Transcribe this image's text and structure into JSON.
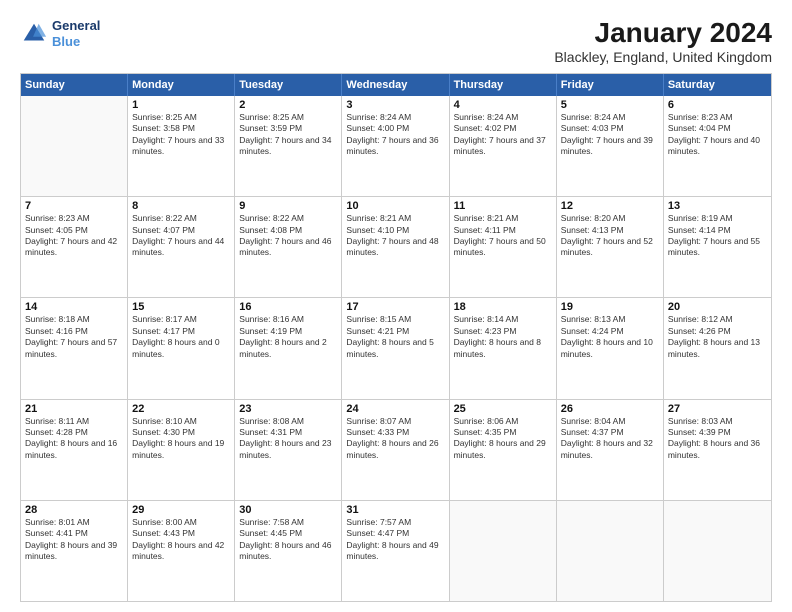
{
  "logo": {
    "line1": "General",
    "line2": "Blue"
  },
  "title": "January 2024",
  "location": "Blackley, England, United Kingdom",
  "weekdays": [
    "Sunday",
    "Monday",
    "Tuesday",
    "Wednesday",
    "Thursday",
    "Friday",
    "Saturday"
  ],
  "weeks": [
    [
      {
        "day": "",
        "sunrise": "",
        "sunset": "",
        "daylight": ""
      },
      {
        "day": "1",
        "sunrise": "Sunrise: 8:25 AM",
        "sunset": "Sunset: 3:58 PM",
        "daylight": "Daylight: 7 hours and 33 minutes."
      },
      {
        "day": "2",
        "sunrise": "Sunrise: 8:25 AM",
        "sunset": "Sunset: 3:59 PM",
        "daylight": "Daylight: 7 hours and 34 minutes."
      },
      {
        "day": "3",
        "sunrise": "Sunrise: 8:24 AM",
        "sunset": "Sunset: 4:00 PM",
        "daylight": "Daylight: 7 hours and 36 minutes."
      },
      {
        "day": "4",
        "sunrise": "Sunrise: 8:24 AM",
        "sunset": "Sunset: 4:02 PM",
        "daylight": "Daylight: 7 hours and 37 minutes."
      },
      {
        "day": "5",
        "sunrise": "Sunrise: 8:24 AM",
        "sunset": "Sunset: 4:03 PM",
        "daylight": "Daylight: 7 hours and 39 minutes."
      },
      {
        "day": "6",
        "sunrise": "Sunrise: 8:23 AM",
        "sunset": "Sunset: 4:04 PM",
        "daylight": "Daylight: 7 hours and 40 minutes."
      }
    ],
    [
      {
        "day": "7",
        "sunrise": "Sunrise: 8:23 AM",
        "sunset": "Sunset: 4:05 PM",
        "daylight": "Daylight: 7 hours and 42 minutes."
      },
      {
        "day": "8",
        "sunrise": "Sunrise: 8:22 AM",
        "sunset": "Sunset: 4:07 PM",
        "daylight": "Daylight: 7 hours and 44 minutes."
      },
      {
        "day": "9",
        "sunrise": "Sunrise: 8:22 AM",
        "sunset": "Sunset: 4:08 PM",
        "daylight": "Daylight: 7 hours and 46 minutes."
      },
      {
        "day": "10",
        "sunrise": "Sunrise: 8:21 AM",
        "sunset": "Sunset: 4:10 PM",
        "daylight": "Daylight: 7 hours and 48 minutes."
      },
      {
        "day": "11",
        "sunrise": "Sunrise: 8:21 AM",
        "sunset": "Sunset: 4:11 PM",
        "daylight": "Daylight: 7 hours and 50 minutes."
      },
      {
        "day": "12",
        "sunrise": "Sunrise: 8:20 AM",
        "sunset": "Sunset: 4:13 PM",
        "daylight": "Daylight: 7 hours and 52 minutes."
      },
      {
        "day": "13",
        "sunrise": "Sunrise: 8:19 AM",
        "sunset": "Sunset: 4:14 PM",
        "daylight": "Daylight: 7 hours and 55 minutes."
      }
    ],
    [
      {
        "day": "14",
        "sunrise": "Sunrise: 8:18 AM",
        "sunset": "Sunset: 4:16 PM",
        "daylight": "Daylight: 7 hours and 57 minutes."
      },
      {
        "day": "15",
        "sunrise": "Sunrise: 8:17 AM",
        "sunset": "Sunset: 4:17 PM",
        "daylight": "Daylight: 8 hours and 0 minutes."
      },
      {
        "day": "16",
        "sunrise": "Sunrise: 8:16 AM",
        "sunset": "Sunset: 4:19 PM",
        "daylight": "Daylight: 8 hours and 2 minutes."
      },
      {
        "day": "17",
        "sunrise": "Sunrise: 8:15 AM",
        "sunset": "Sunset: 4:21 PM",
        "daylight": "Daylight: 8 hours and 5 minutes."
      },
      {
        "day": "18",
        "sunrise": "Sunrise: 8:14 AM",
        "sunset": "Sunset: 4:23 PM",
        "daylight": "Daylight: 8 hours and 8 minutes."
      },
      {
        "day": "19",
        "sunrise": "Sunrise: 8:13 AM",
        "sunset": "Sunset: 4:24 PM",
        "daylight": "Daylight: 8 hours and 10 minutes."
      },
      {
        "day": "20",
        "sunrise": "Sunrise: 8:12 AM",
        "sunset": "Sunset: 4:26 PM",
        "daylight": "Daylight: 8 hours and 13 minutes."
      }
    ],
    [
      {
        "day": "21",
        "sunrise": "Sunrise: 8:11 AM",
        "sunset": "Sunset: 4:28 PM",
        "daylight": "Daylight: 8 hours and 16 minutes."
      },
      {
        "day": "22",
        "sunrise": "Sunrise: 8:10 AM",
        "sunset": "Sunset: 4:30 PM",
        "daylight": "Daylight: 8 hours and 19 minutes."
      },
      {
        "day": "23",
        "sunrise": "Sunrise: 8:08 AM",
        "sunset": "Sunset: 4:31 PM",
        "daylight": "Daylight: 8 hours and 23 minutes."
      },
      {
        "day": "24",
        "sunrise": "Sunrise: 8:07 AM",
        "sunset": "Sunset: 4:33 PM",
        "daylight": "Daylight: 8 hours and 26 minutes."
      },
      {
        "day": "25",
        "sunrise": "Sunrise: 8:06 AM",
        "sunset": "Sunset: 4:35 PM",
        "daylight": "Daylight: 8 hours and 29 minutes."
      },
      {
        "day": "26",
        "sunrise": "Sunrise: 8:04 AM",
        "sunset": "Sunset: 4:37 PM",
        "daylight": "Daylight: 8 hours and 32 minutes."
      },
      {
        "day": "27",
        "sunrise": "Sunrise: 8:03 AM",
        "sunset": "Sunset: 4:39 PM",
        "daylight": "Daylight: 8 hours and 36 minutes."
      }
    ],
    [
      {
        "day": "28",
        "sunrise": "Sunrise: 8:01 AM",
        "sunset": "Sunset: 4:41 PM",
        "daylight": "Daylight: 8 hours and 39 minutes."
      },
      {
        "day": "29",
        "sunrise": "Sunrise: 8:00 AM",
        "sunset": "Sunset: 4:43 PM",
        "daylight": "Daylight: 8 hours and 42 minutes."
      },
      {
        "day": "30",
        "sunrise": "Sunrise: 7:58 AM",
        "sunset": "Sunset: 4:45 PM",
        "daylight": "Daylight: 8 hours and 46 minutes."
      },
      {
        "day": "31",
        "sunrise": "Sunrise: 7:57 AM",
        "sunset": "Sunset: 4:47 PM",
        "daylight": "Daylight: 8 hours and 49 minutes."
      },
      {
        "day": "",
        "sunrise": "",
        "sunset": "",
        "daylight": ""
      },
      {
        "day": "",
        "sunrise": "",
        "sunset": "",
        "daylight": ""
      },
      {
        "day": "",
        "sunrise": "",
        "sunset": "",
        "daylight": ""
      }
    ]
  ]
}
